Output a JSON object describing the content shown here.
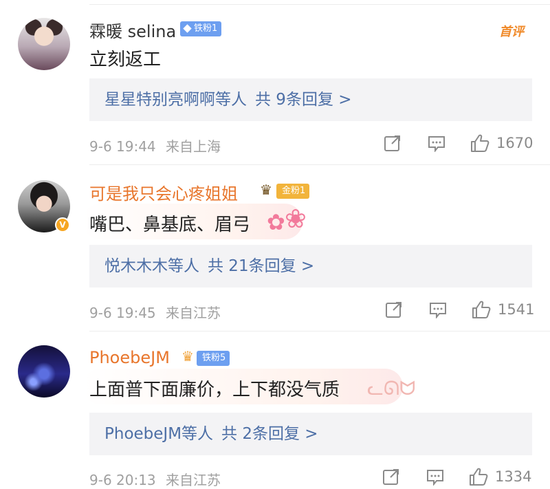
{
  "first_comment_tag": "首评",
  "comments": [
    {
      "username": "霖暖 selina",
      "badge": "铁粉1",
      "text": "立刻返工",
      "replies_names": "星星特别亮啊啊等人",
      "replies_count": "共 9条回复 >",
      "time": "9-6 19:44",
      "source": "来自上海",
      "likes": "1670"
    },
    {
      "username": "可是我只会心疼姐姐",
      "badge": "金粉1",
      "text": "嘴巴、鼻基底、眉弓",
      "replies_names": "悦木木木等人",
      "replies_count": "共 21条回复 >",
      "time": "9-6 19:45",
      "source": "来自江苏",
      "likes": "1541"
    },
    {
      "username": "PhoebeJM",
      "badge": "铁粉5",
      "text": "上面普下面廉价，上下都没气质",
      "replies_names": "PhoebeJM等人",
      "replies_count": "共 2条回复 >",
      "time": "9-6 20:13",
      "source": "来自江苏",
      "likes": "1334"
    }
  ],
  "colors": {
    "accent_orange": "#e8762c",
    "link_blue": "#4d6fa6",
    "reply_bg": "#f3f3f5"
  },
  "icons": [
    "share-icon",
    "comment-icon",
    "like-icon",
    "verified-badge-icon",
    "crown-icon",
    "flower-sticker"
  ]
}
